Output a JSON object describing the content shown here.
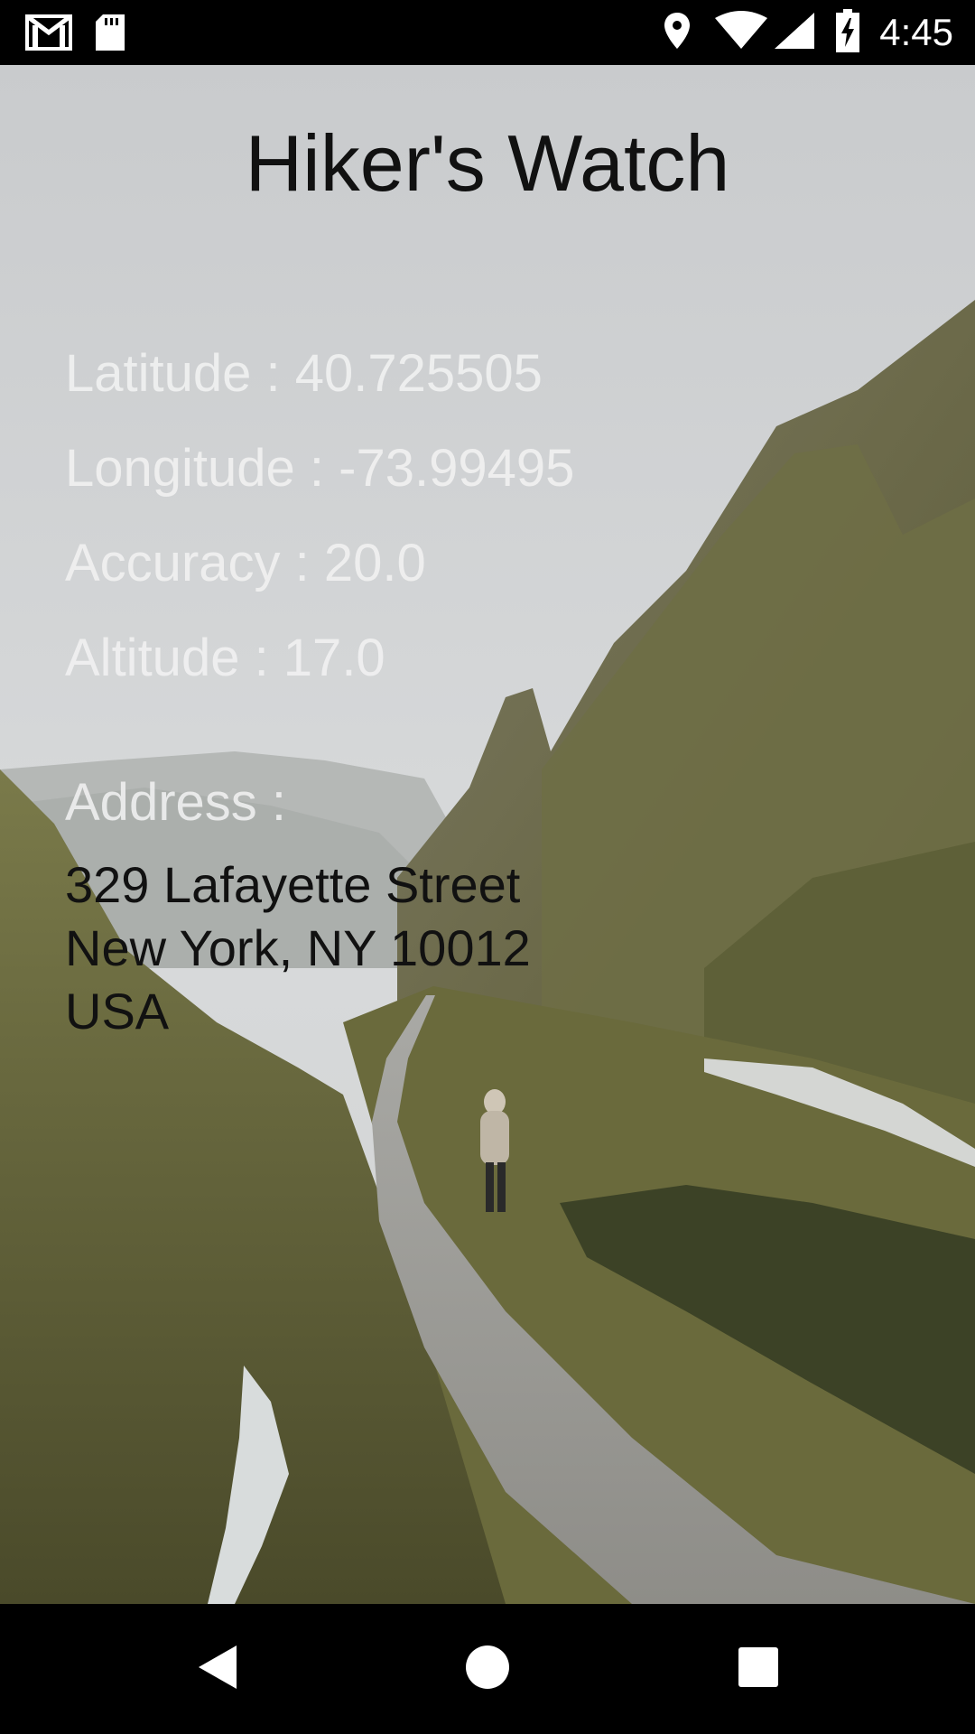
{
  "status_bar": {
    "time": "4:45",
    "left_icons": [
      "gmail-icon",
      "sd-card-icon"
    ],
    "right_icons": [
      "location-icon",
      "wifi-icon",
      "signal-icon",
      "battery-charging-icon"
    ]
  },
  "app": {
    "title": "Hiker's Watch",
    "latitude": "Latitude : 40.725505",
    "longitude": "Longitude : -73.99495",
    "accuracy": "Accuracy : 20.0",
    "altitude": "Altitude : 17.0",
    "address_label": "Address :",
    "address_lines": [
      "329 Lafayette Street",
      "New York, NY 10012",
      "USA"
    ]
  },
  "nav_bar": {
    "buttons": [
      "back-icon",
      "home-icon",
      "recents-icon"
    ]
  }
}
